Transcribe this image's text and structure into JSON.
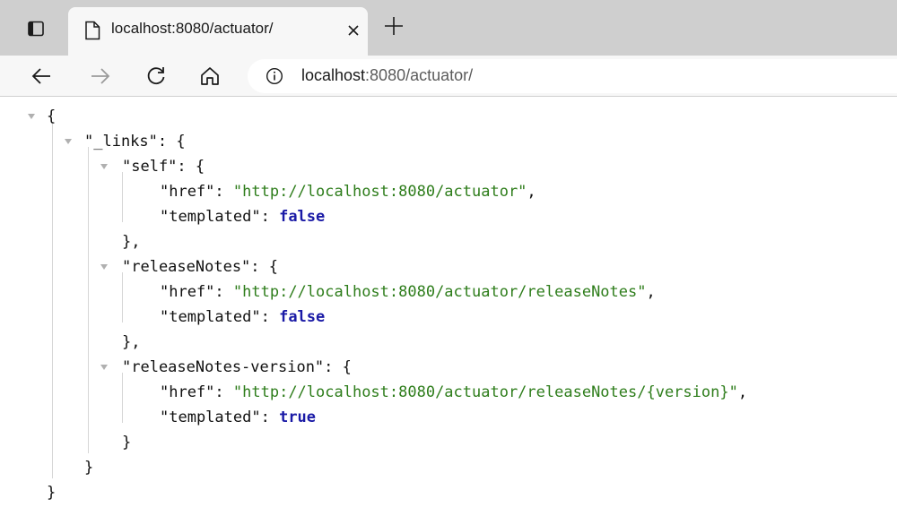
{
  "browser": {
    "tab": {
      "title": "localhost:8080/actuator/"
    },
    "address_bar": {
      "host": "localhost",
      "rest": ":8080/actuator/"
    }
  },
  "json": {
    "links_key": "\"_links\"",
    "self_key": "\"self\"",
    "release_notes_key": "\"releaseNotes\"",
    "release_notes_version_key": "\"releaseNotes-version\"",
    "href_key": "\"href\"",
    "templated_key": "\"templated\"",
    "self_href": "\"http://localhost:8080/actuator\"",
    "self_templated": "false",
    "release_notes_href": "\"http://localhost:8080/actuator/releaseNotes\"",
    "release_notes_templated": "false",
    "release_notes_version_href": "\"http://localhost:8080/actuator/releaseNotes/{version}\"",
    "release_notes_version_templated": "true"
  },
  "colors": {
    "string": "#2e7d1b",
    "boolean": "#1a1aa6",
    "tabstrip": "#cfcfcf",
    "toolbar": "#f7f7f7"
  },
  "icons": [
    "tab-actions-icon",
    "page-icon",
    "close-icon",
    "plus-icon",
    "back-arrow-icon",
    "forward-arrow-icon",
    "refresh-icon",
    "home-icon",
    "info-icon",
    "collapse-triangle-icon"
  ]
}
